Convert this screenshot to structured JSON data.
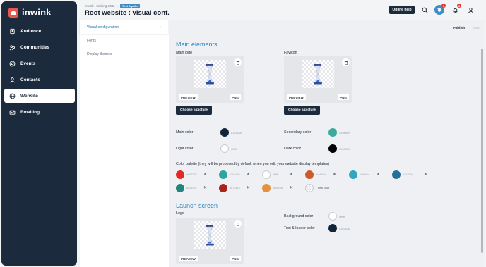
{
  "app": {
    "logo_text": "inwink"
  },
  "sidebar": {
    "items": [
      {
        "label": "Audience",
        "icon": "id-badge-icon"
      },
      {
        "label": "Communities",
        "icon": "communities-icon"
      },
      {
        "label": "Events",
        "icon": "target-icon"
      },
      {
        "label": "Contacts",
        "icon": "contacts-icon"
      },
      {
        "label": "Website",
        "icon": "globe-icon",
        "active": true
      },
      {
        "label": "Emailing",
        "icon": "mail-icon"
      }
    ]
  },
  "header": {
    "breadcrumb": "inwink - training CSM",
    "breadcrumb_sep": "›",
    "badge": "Test Agathe",
    "title": "Root website : visual conf.",
    "help_label": "Online help",
    "notif_counts": [
      "3",
      "3"
    ]
  },
  "subnav": {
    "items": [
      {
        "label": "Visual configuration",
        "chevron": "›",
        "active": true
      },
      {
        "label": "Fonts"
      },
      {
        "label": "Display themes"
      }
    ]
  },
  "toolbar": {
    "publish_label": "Publish",
    "save_label": "Save"
  },
  "main_elements": {
    "title": "Main elements",
    "main_logo_label": "Main logo",
    "favicon_label": "Favicon",
    "preview_tag": "PREVIEW",
    "png_tag": "PNG",
    "choose_label": "Choose a picture",
    "colors": {
      "main": {
        "label": "Main color",
        "hex": "#10243a",
        "value": "#10243a"
      },
      "secondary": {
        "label": "Secondary color",
        "hex": "#39aa9e",
        "value": "#39aa9e"
      },
      "light": {
        "label": "Light color",
        "hex": "#ffffff",
        "value": "#ffffff"
      },
      "dark": {
        "label": "Dark color",
        "hex": "#000000",
        "value": "#000000"
      }
    },
    "palette_label": "Color palette (they will be proposed by default when you edit your website display templates)",
    "palette": [
      {
        "hex": "#e52725",
        "value": "#e52725"
      },
      {
        "hex": "#30a49e",
        "value": "#30a49e"
      },
      {
        "hex": "#ffffff",
        "value": "#ffffff"
      },
      {
        "hex": "#cc5b2b",
        "value": "#cc5b2b"
      },
      {
        "hex": "#36a6bf",
        "value": "#36a6bf"
      },
      {
        "hex": "#24709d",
        "value": "#24709d"
      },
      {
        "hex": "#20877c",
        "value": "#20877c"
      },
      {
        "hex": "#a7251e",
        "value": "#a7251e"
      },
      {
        "hex": "#e6923d",
        "value": "#e6923d"
      }
    ],
    "new_color_label": "new color"
  },
  "launch_screen": {
    "title": "Launch screen",
    "logo_label": "Logo",
    "background": {
      "label": "Background color",
      "hex": "#ffffff",
      "value": "#ffffff"
    },
    "loader": {
      "label": "Text & loader color",
      "hex": "#10243a",
      "value": "#10243a"
    }
  }
}
